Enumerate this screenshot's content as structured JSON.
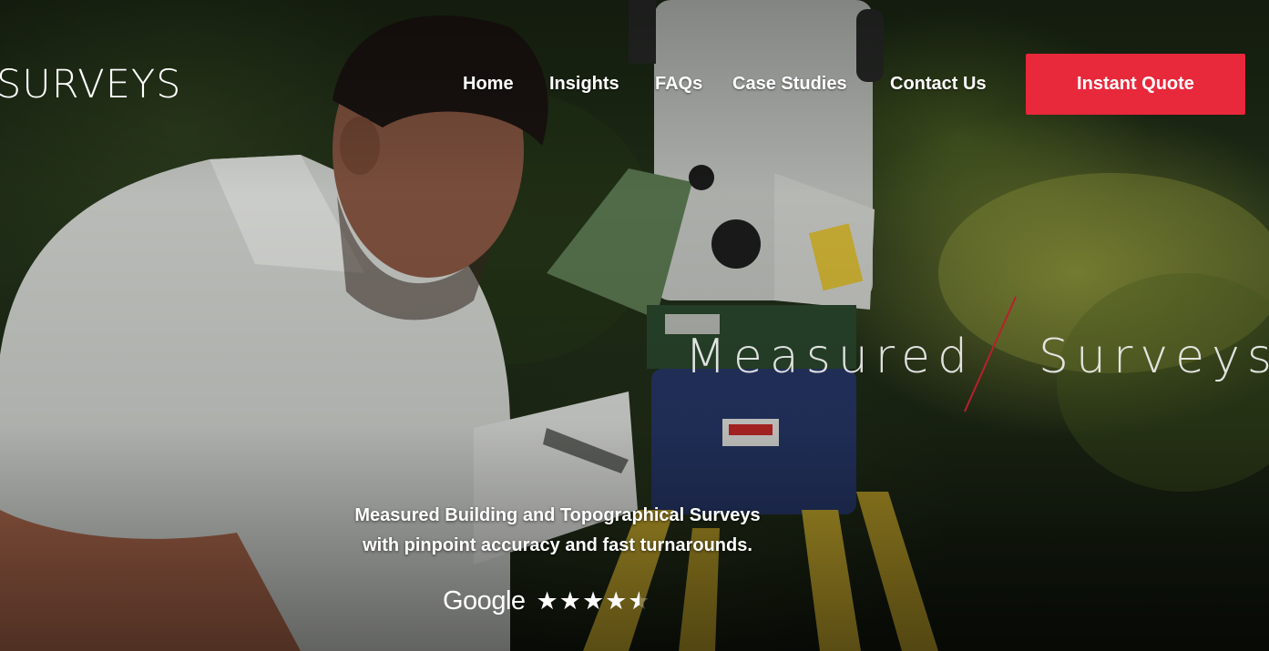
{
  "header": {
    "logo_text": "SURVEYS",
    "nav": [
      {
        "label": "Home"
      },
      {
        "label": "Insights"
      },
      {
        "label": "FAQs"
      },
      {
        "label": "Case Studies"
      },
      {
        "label": "Contact Us"
      }
    ],
    "cta_label": "Instant Quote"
  },
  "hero": {
    "headline_word_1": "Measured",
    "headline_word_2": "Surveys",
    "tagline_line_1": "Measured Building and Topographical Surveys",
    "tagline_line_2": "with pinpoint accuracy and fast turnarounds.",
    "rating_source": "Google",
    "rating_stars": 4.5
  },
  "colors": {
    "accent": "#e8283b",
    "slash": "#b8202c",
    "text": "#ffffff"
  },
  "icons": {
    "star": "star-icon",
    "half_star": "half-star-icon"
  }
}
